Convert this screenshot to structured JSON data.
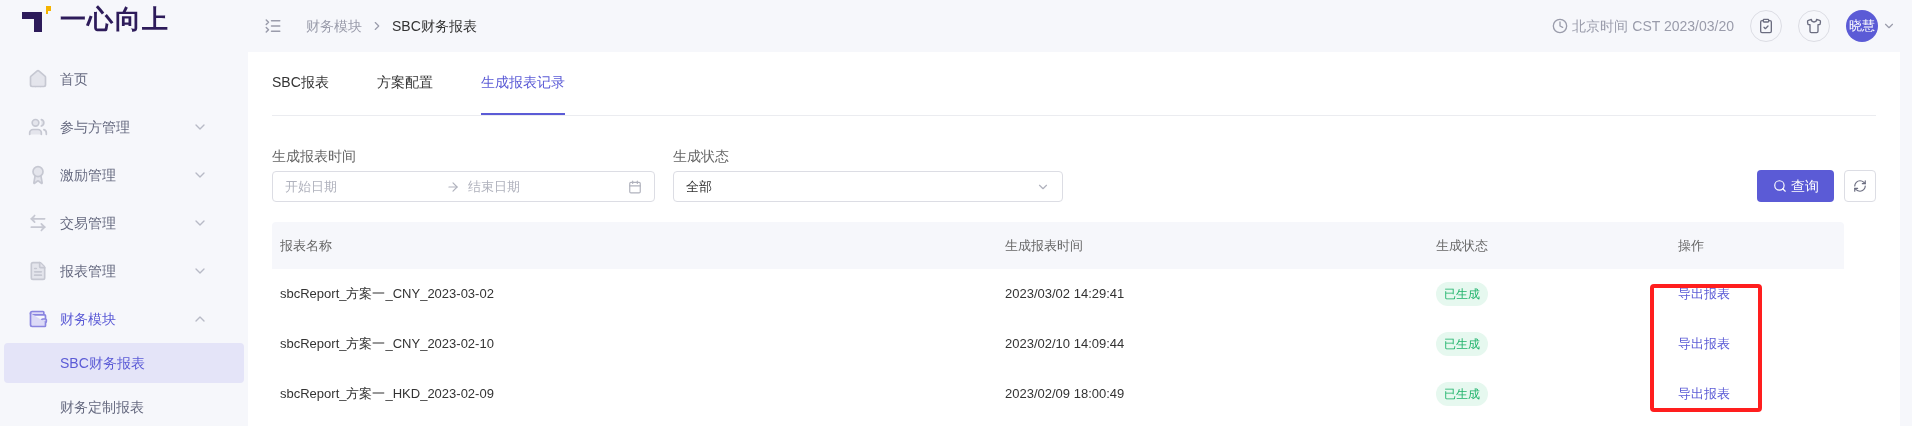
{
  "logo": {
    "text": "一心向上"
  },
  "sidebar": {
    "items": [
      {
        "label": "首页",
        "selected": false
      },
      {
        "label": "参与方管理",
        "expanded": false,
        "selected": false
      },
      {
        "label": "激励管理",
        "expanded": false,
        "selected": false
      },
      {
        "label": "交易管理",
        "expanded": false,
        "selected": false
      },
      {
        "label": "报表管理",
        "expanded": false,
        "selected": false
      },
      {
        "label": "财务模块",
        "expanded": true,
        "selected": true,
        "children": [
          {
            "label": "SBC财务报表",
            "selected": true
          },
          {
            "label": "财务定制报表",
            "selected": false
          }
        ]
      }
    ]
  },
  "header": {
    "breadcrumb": [
      "财务模块",
      "SBC财务报表"
    ],
    "clock": "北京时间 CST 2023/03/20",
    "avatar": "晓慧"
  },
  "tabs": [
    {
      "label": "SBC报表",
      "selected": false
    },
    {
      "label": "方案配置",
      "selected": false
    },
    {
      "label": "生成报表记录",
      "selected": true
    }
  ],
  "filters": {
    "date_range": {
      "label": "生成报表时间",
      "start_placeholder": "开始日期",
      "end_placeholder": "结束日期"
    },
    "status": {
      "label": "生成状态",
      "value": "全部"
    },
    "query_button": "查询"
  },
  "table": {
    "columns": [
      "报表名称",
      "生成报表时间",
      "生成状态",
      "操作"
    ],
    "rows": [
      {
        "name": "sbcReport_方案一_CNY_2023-03-02",
        "time": "2023/03/02 14:29:41",
        "status": "已生成",
        "action": "导出报表"
      },
      {
        "name": "sbcReport_方案一_CNY_2023-02-10",
        "time": "2023/02/10 14:09:44",
        "status": "已生成",
        "action": "导出报表"
      },
      {
        "name": "sbcReport_方案一_HKD_2023-02-09",
        "time": "2023/02/09 18:00:49",
        "status": "已生成",
        "action": "导出报表"
      }
    ]
  },
  "annotation": {
    "kind": "highlight-box",
    "color": "#ff1e1e"
  }
}
